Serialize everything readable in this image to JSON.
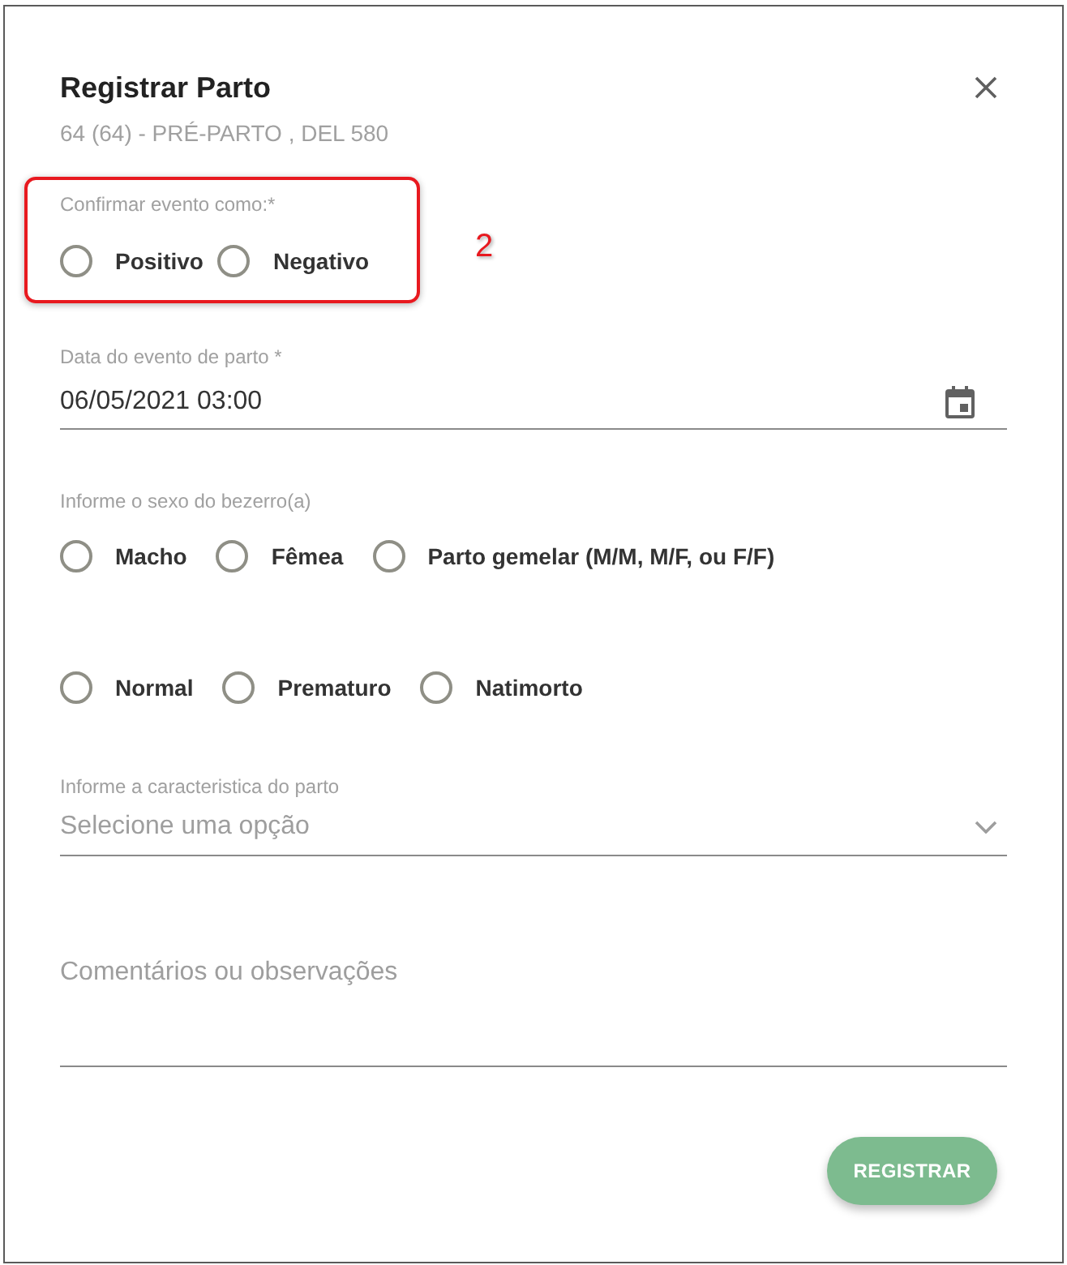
{
  "dialog": {
    "title": "Registrar Parto",
    "subtitle": "64 (64) - PRÉ-PARTO , DEL 580"
  },
  "confirm_group": {
    "label": "Confirmar evento como:*",
    "options": [
      {
        "label": "Positivo",
        "selected": false
      },
      {
        "label": "Negativo",
        "selected": false
      }
    ]
  },
  "annotation": {
    "label": "2"
  },
  "date_field": {
    "label": "Data do evento de parto *",
    "value": "06/05/2021 03:00"
  },
  "sex_group": {
    "label": "Informe o sexo do bezerro(a)",
    "options": [
      {
        "label": "Macho",
        "selected": false
      },
      {
        "label": "Fêmea",
        "selected": false
      },
      {
        "label": "Parto gemelar (M/M, M/F, ou F/F)",
        "selected": false
      }
    ]
  },
  "condition_group": {
    "options": [
      {
        "label": "Normal",
        "selected": false
      },
      {
        "label": "Prematuro",
        "selected": false
      },
      {
        "label": "Natimorto",
        "selected": false
      }
    ]
  },
  "characteristic_select": {
    "label": "Informe a caracteristica do parto",
    "placeholder": "Selecione uma opção"
  },
  "comments": {
    "placeholder": "Comentários ou observações"
  },
  "buttons": [
    {
      "label": "REGISTRAR"
    }
  ]
}
